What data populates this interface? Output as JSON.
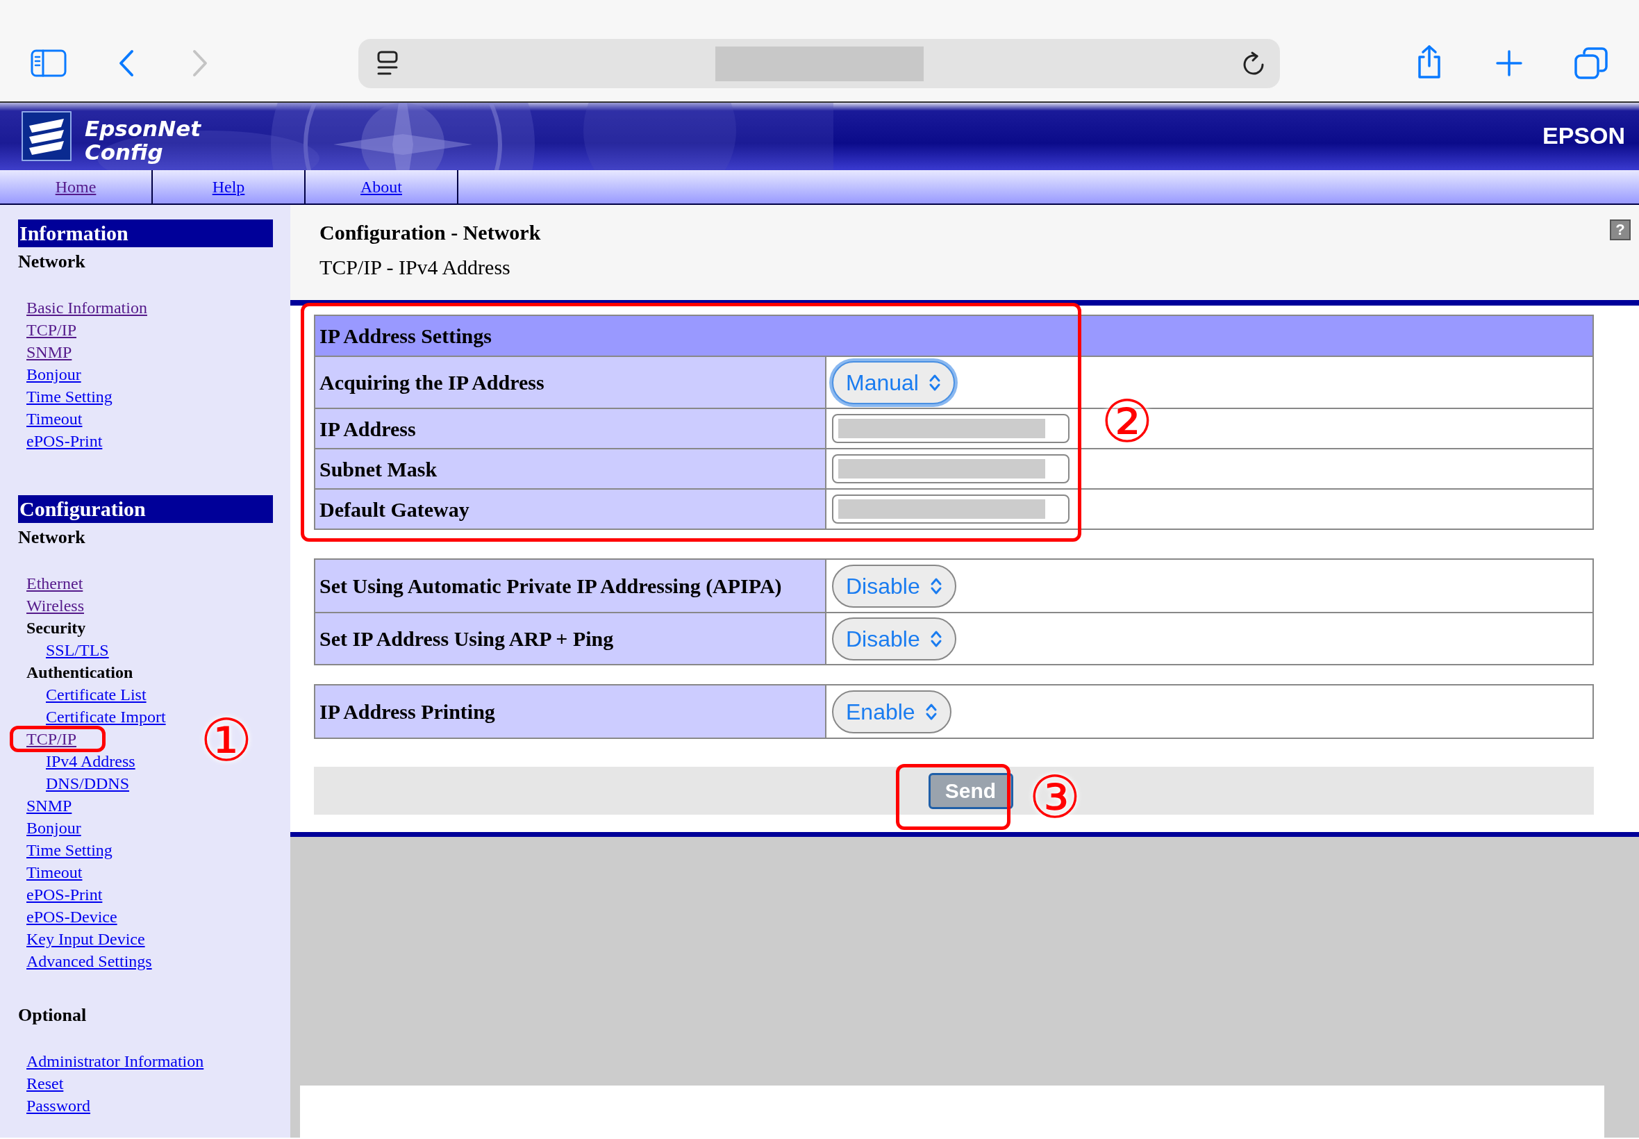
{
  "browser": {
    "back_disabled": false,
    "forward_disabled": true
  },
  "header": {
    "logo_line1": "EpsonNet",
    "logo_line2": "Config",
    "brand": "EPSON"
  },
  "nav": [
    {
      "label": "Home",
      "visited": true
    },
    {
      "label": "Help",
      "visited": false
    },
    {
      "label": "About",
      "visited": false
    }
  ],
  "sidebar": [
    {
      "title": "Information",
      "kind": "bar",
      "heading": "Network",
      "items": [
        {
          "label": "Basic Information",
          "kind": "link",
          "visited": true
        },
        {
          "label": "TCP/IP",
          "kind": "link",
          "visited": true
        },
        {
          "label": "SNMP",
          "kind": "link",
          "visited": true
        },
        {
          "label": "Bonjour",
          "kind": "link",
          "visited": false
        },
        {
          "label": "Time Setting",
          "kind": "link",
          "visited": false
        },
        {
          "label": "Timeout",
          "kind": "link",
          "visited": false
        },
        {
          "label": "ePOS-Print",
          "kind": "link",
          "visited": false
        }
      ]
    },
    {
      "title": "Configuration",
      "kind": "bar",
      "heading": "Network",
      "items": [
        {
          "label": "Ethernet",
          "kind": "link",
          "visited": true
        },
        {
          "label": "Wireless",
          "kind": "link",
          "visited": true
        },
        {
          "label": "Security",
          "kind": "label",
          "children": [
            {
              "label": "SSL/TLS",
              "kind": "link",
              "visited": false
            }
          ]
        },
        {
          "label": "Authentication",
          "kind": "label",
          "children": [
            {
              "label": "Certificate List",
              "kind": "link",
              "visited": false
            },
            {
              "label": "Certificate Import",
              "kind": "link",
              "visited": false
            }
          ]
        },
        {
          "label": "TCP/IP",
          "kind": "link",
          "visited": true,
          "children": [
            {
              "label": "IPv4 Address",
              "kind": "link",
              "visited": false
            },
            {
              "label": "DNS/DDNS",
              "kind": "link",
              "visited": false
            }
          ]
        },
        {
          "label": "SNMP",
          "kind": "link",
          "visited": false
        },
        {
          "label": "Bonjour",
          "kind": "link",
          "visited": false
        },
        {
          "label": "Time Setting",
          "kind": "link",
          "visited": false
        },
        {
          "label": "Timeout",
          "kind": "link",
          "visited": false
        },
        {
          "label": "ePOS-Print",
          "kind": "link",
          "visited": false
        },
        {
          "label": "ePOS-Device",
          "kind": "link",
          "visited": false
        },
        {
          "label": "Key Input Device",
          "kind": "link",
          "visited": false
        },
        {
          "label": "Advanced Settings",
          "kind": "link",
          "visited": false
        }
      ]
    },
    {
      "title": "Optional",
      "kind": "plain",
      "items": [
        {
          "label": "Administrator Information",
          "kind": "link",
          "visited": false
        },
        {
          "label": "Reset",
          "kind": "link",
          "visited": false
        },
        {
          "label": "Password",
          "kind": "link",
          "visited": false
        }
      ]
    }
  ],
  "main": {
    "title": "Configuration - Network",
    "subtitle": "TCP/IP - IPv4 Address",
    "help_button": "?",
    "tables": [
      {
        "header": "IP Address Settings",
        "rows": [
          {
            "label": "Acquiring the IP Address",
            "kind": "select",
            "value": "Manual",
            "focused": true
          },
          {
            "label": "IP Address",
            "kind": "input"
          },
          {
            "label": "Subnet Mask",
            "kind": "input"
          },
          {
            "label": "Default Gateway",
            "kind": "input"
          }
        ]
      },
      {
        "rows": [
          {
            "label": "Set Using Automatic Private IP Addressing (APIPA)",
            "kind": "select",
            "value": "Disable",
            "focused": false
          },
          {
            "label": "Set IP Address Using ARP + Ping",
            "kind": "select",
            "value": "Disable",
            "focused": false
          }
        ]
      },
      {
        "rows": [
          {
            "label": "IP Address Printing",
            "kind": "select",
            "value": "Enable",
            "focused": false
          }
        ]
      }
    ],
    "send_button": "Send"
  },
  "callouts": [
    {
      "label": "①"
    },
    {
      "label": "②"
    },
    {
      "label": "③"
    }
  ]
}
